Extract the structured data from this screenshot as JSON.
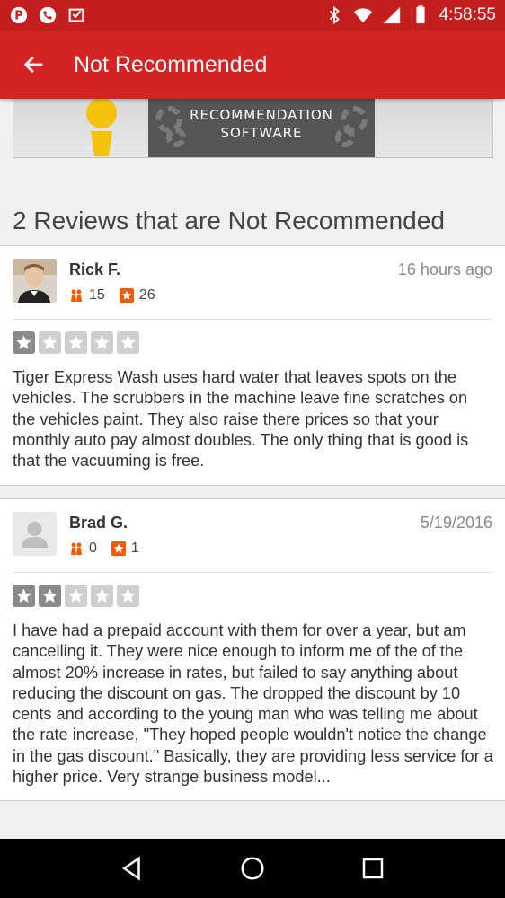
{
  "statusbar": {
    "time": "4:58:55",
    "left_icons": [
      "pinterest-icon",
      "phone-icon",
      "inbox-check-icon"
    ],
    "right_icons": [
      "bluetooth-icon",
      "wifi-icon",
      "signal-icon",
      "battery-icon"
    ]
  },
  "appbar": {
    "title": "Not Recommended"
  },
  "banner": {
    "line1": "RECOMMENDATION",
    "line2": "SOFTWARE"
  },
  "section": {
    "title": "2 Reviews that are Not Recommended"
  },
  "reviews": [
    {
      "name": "Rick F.",
      "date": "16 hours ago",
      "friends": "15",
      "review_count": "26",
      "rating": 1,
      "text": "Tiger Express Wash uses hard water that leaves spots on the vehicles. The scrubbers in the machine leave fine scratches on the vehicles paint. They also raise there prices so that your monthly auto pay almost doubles. The only thing that is good is that the vacuuming is free."
    },
    {
      "name": "Brad G.",
      "date": "5/19/2016",
      "friends": "0",
      "review_count": "1",
      "rating": 2,
      "text": "I have had a prepaid account with them for over a year, but am cancelling it.  They were nice enough to inform me of the of the almost 20% increase in rates, but failed to say anything about reducing the discount on gas.  The dropped the discount by 10 cents and according to the young man who was telling me about the rate increase, \"They hoped people wouldn't notice the change in the gas discount.\"  Basically, they are providing less service for a higher price.  Very strange business model..."
    }
  ],
  "colors": {
    "brand_red": "#d32323",
    "status_red": "#c41f1f",
    "star_on": "#8a8a8a",
    "star_off": "#cfcfcf",
    "badge_orange": "#f15c00"
  }
}
